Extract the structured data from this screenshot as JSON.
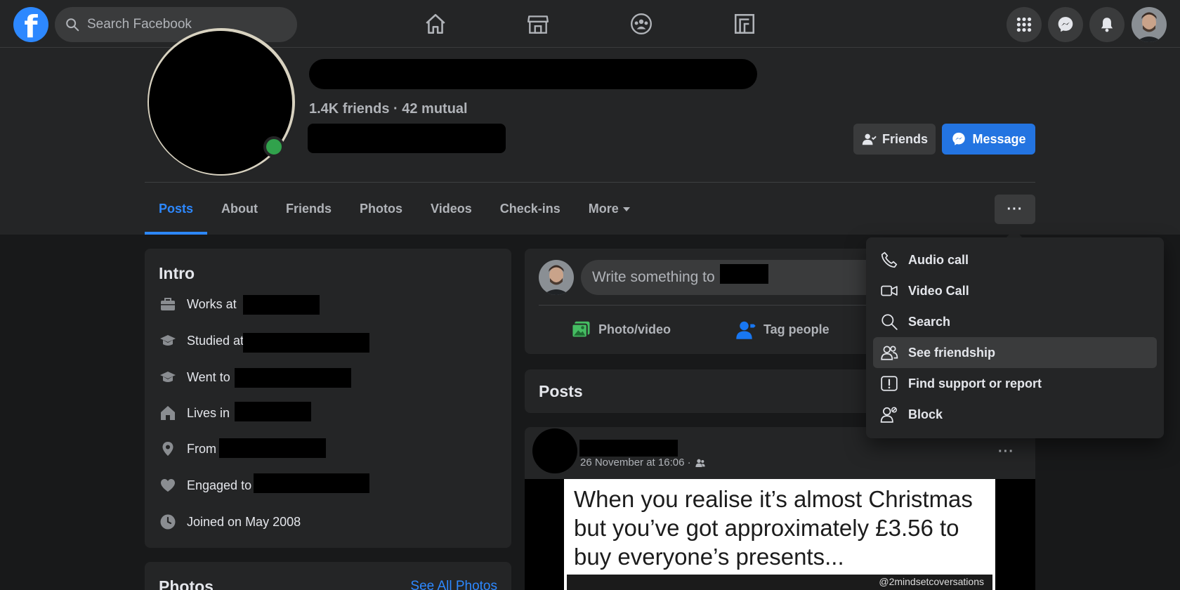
{
  "topbar": {
    "logo": "f",
    "search_placeholder": "Search Facebook",
    "nav_icons": [
      "home-icon",
      "marketplace-icon",
      "groups-icon",
      "gaming-icon"
    ],
    "right_icons": [
      "menu-grid-icon",
      "messenger-icon",
      "notifications-icon"
    ]
  },
  "profile": {
    "friends_count": "1.4K friends · 42 mutual",
    "friends_button": "Friends",
    "message_button": "Message"
  },
  "tabs": [
    {
      "label": "Posts",
      "active": true
    },
    {
      "label": "About"
    },
    {
      "label": "Friends"
    },
    {
      "label": "Photos"
    },
    {
      "label": "Videos"
    },
    {
      "label": "Check-ins"
    },
    {
      "label": "More"
    }
  ],
  "more_actions": "···",
  "intro": {
    "title": "Intro",
    "rows": [
      {
        "icon": "briefcase-icon",
        "text": "Works at"
      },
      {
        "icon": "graduation-cap-icon",
        "text": "Studied at"
      },
      {
        "icon": "graduation-cap-icon",
        "text": "Went to"
      },
      {
        "icon": "home-icon",
        "text": "Lives in"
      },
      {
        "icon": "location-pin-icon",
        "text": "From"
      },
      {
        "icon": "heart-icon",
        "text": "Engaged to"
      },
      {
        "icon": "clock-icon",
        "text": "Joined on May 2008"
      }
    ]
  },
  "photos": {
    "title": "Photos",
    "see_all": "See All Photos"
  },
  "composer": {
    "placeholder": "Write something to",
    "photo_video": "Photo/video",
    "tag_people": "Tag people"
  },
  "posts_heading": "Posts",
  "post": {
    "timestamp": "26 November at 16:06 ·",
    "meme_text": "When you realise it’s almost Christmas but you’ve got approximately £3.56 to buy everyone’s presents...",
    "watermark": "@2mindsetcoversations"
  },
  "menu": {
    "items": [
      {
        "label": "Audio call",
        "icon": "phone-icon"
      },
      {
        "label": "Video Call",
        "icon": "video-camera-icon"
      },
      {
        "label": "Search",
        "icon": "search-icon"
      },
      {
        "label": "See friendship",
        "icon": "friends-icon",
        "hover": true
      },
      {
        "label": "Find support or report",
        "icon": "report-icon"
      },
      {
        "label": "Block",
        "icon": "block-user-icon"
      }
    ]
  },
  "colors": {
    "accent": "#2d88ff",
    "message_button": "#2374e1",
    "online": "#31a24c",
    "background": "#18191a",
    "surface": "#242526"
  }
}
